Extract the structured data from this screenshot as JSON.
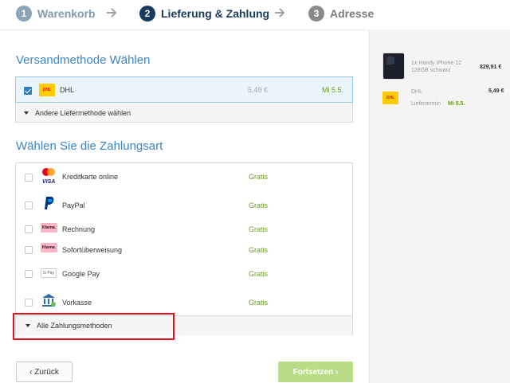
{
  "stepper": {
    "steps": [
      {
        "num": "1",
        "label": "Warenkorb"
      },
      {
        "num": "2",
        "label": "Lieferung & Zahlung"
      },
      {
        "num": "3",
        "label": "Adresse"
      }
    ]
  },
  "shipping": {
    "title": "Versandmethode Wählen",
    "option": {
      "name": "DHL",
      "price": "5,49 €",
      "date": "Mi 5.5.",
      "logo_text": "DHL"
    },
    "more_label": "Andere Liefermethode wählen"
  },
  "payment": {
    "title": "Wählen Sie die Zahlungsart",
    "methods": [
      {
        "name": "Kreditkarte online",
        "price": "Gratis",
        "icon": "mastercard-visa-icon"
      },
      {
        "name": "PayPal",
        "price": "Gratis",
        "icon": "paypal-icon"
      },
      {
        "name": "Rechnung",
        "price": "Gratis",
        "icon": "klarna-icon",
        "logo_text": "Klarna."
      },
      {
        "name": "Sofortüberweisung",
        "price": "Gratis",
        "icon": "klarna-icon",
        "logo_text": "Klarna."
      },
      {
        "name": "Google Pay",
        "price": "Gratis",
        "icon": "google-pay-icon",
        "logo_text": "G Pay"
      },
      {
        "name": "Vorkasse",
        "price": "Gratis",
        "icon": "bank-icon"
      }
    ],
    "all_label": "Alle Zahlungsmethoden"
  },
  "buttons": {
    "back": "‹ Zurück",
    "next": "Fortsetzen ›"
  },
  "summary": {
    "product_line1": "1x Handy iPhone 12",
    "product_line2": "128GB schwarz",
    "product_price": "829,91 €",
    "shipping_name": "DHL",
    "shipping_price": "5,49 €",
    "delivery_label": "Liefertermin",
    "delivery_date": "Mi 5.5."
  },
  "colors": {
    "accent_blue": "#3c86c6",
    "active_step": "#173a5e",
    "green": "#6a9a1f",
    "highlight_red": "#d9141b",
    "next_button": "#b9dd86"
  }
}
